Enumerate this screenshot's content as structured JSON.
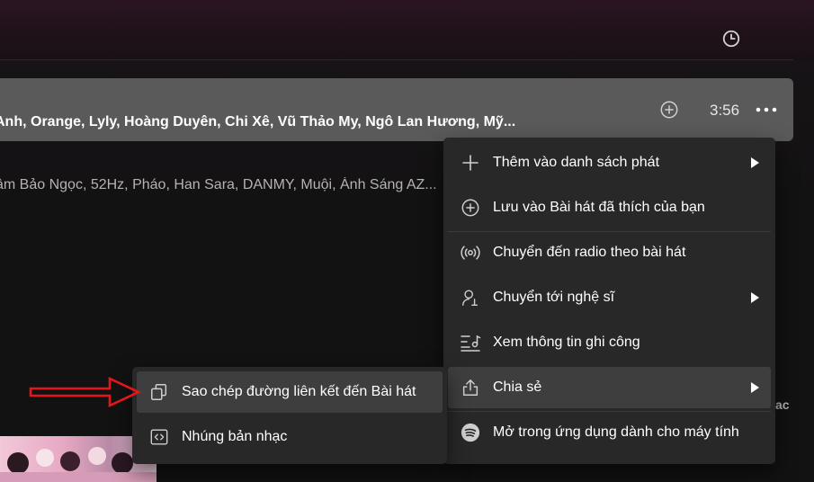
{
  "header": {
    "history_icon": "clock-icon"
  },
  "track": {
    "artists": "Anh, Orange, Lyly, Hoàng Duyên, Chi Xê, Vũ Thảo My, Ngô Lan Hương, Mỹ...",
    "duration": "3:56",
    "add_icon": "plus-circle-icon",
    "more_icon": "more-dots-icon"
  },
  "next_row": {
    "artists": "âm Bảo Ngọc, 52Hz, Pháo, Han Sara, DANMY, Muội, Ánh Sáng AZ..."
  },
  "right_edge_text": "ac",
  "context_menu": {
    "items": [
      {
        "label": "Thêm vào danh sách phát",
        "icon": "plus-icon",
        "has_submenu": true
      },
      {
        "label": "Lưu vào Bài hát đã thích của bạn",
        "icon": "plus-circle-icon",
        "has_submenu": false
      },
      {
        "label": "Chuyển đến radio theo bài hát",
        "icon": "radio-icon",
        "has_submenu": false
      },
      {
        "label": "Chuyển tới nghệ sĩ",
        "icon": "artist-icon",
        "has_submenu": true
      },
      {
        "label": "Xem thông tin ghi công",
        "icon": "credits-icon",
        "has_submenu": false
      },
      {
        "label": "Chia sẻ",
        "icon": "share-icon",
        "has_submenu": true,
        "active": true
      },
      {
        "label": "Mở trong ứng dụng dành cho máy tính",
        "icon": "spotify-icon",
        "has_submenu": false
      }
    ]
  },
  "share_submenu": {
    "items": [
      {
        "label": "Sao chép đường liên kết đến Bài hát",
        "icon": "copy-icon",
        "active": true
      },
      {
        "label": "Nhúng bản nhạc",
        "icon": "embed-icon"
      }
    ]
  },
  "colors": {
    "menu_bg": "#282828",
    "menu_hover": "#3e3e3e",
    "row_highlight": "#5a5a5a",
    "annotation_arrow": "#e8141b"
  }
}
